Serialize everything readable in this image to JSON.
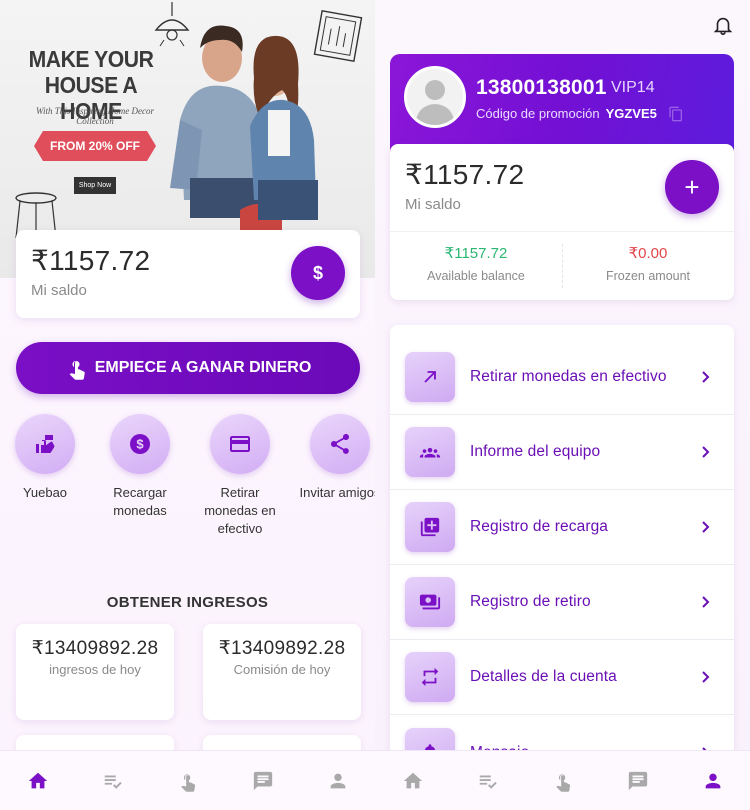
{
  "colors": {
    "accent": "#7b10c6",
    "green": "#2bb673",
    "red": "#e0454a"
  },
  "banner": {
    "headline": "MAKE YOUR HOUSE A HOME",
    "subtitle": "With This Inspiring Home Decor Collection",
    "ribbon": "FROM 20% OFF",
    "shop_now": "Shop Now"
  },
  "left": {
    "balance_amount": "₹1157.72",
    "balance_label": "Mi saldo",
    "earn_button": "EMPIECE A GANAR DINERO",
    "quick_actions": [
      {
        "label": "Yuebao",
        "icon": "wallet-hand-icon"
      },
      {
        "label": "Recargar monedas",
        "icon": "dollar-circle-icon"
      },
      {
        "label": "Retirar monedas en efectivo",
        "icon": "card-icon"
      },
      {
        "label": "Invitar amigos",
        "icon": "share-icon"
      }
    ],
    "section_title": "OBTENER INGRESOS",
    "stats": [
      {
        "value": "₹13409892.28",
        "caption": "ingresos de hoy"
      },
      {
        "value": "₹13409892.28",
        "caption": "Comisión de hoy"
      }
    ]
  },
  "right": {
    "phone": "13800138001",
    "vip": "VIP14",
    "promo_label": "Código de promoción",
    "promo_code": "YGZVE5",
    "balance_amount": "₹1157.72",
    "balance_label": "Mi saldo",
    "available_value": "₹1157.72",
    "available_label": "Available balance",
    "frozen_value": "₹0.00",
    "frozen_label": "Frozen amount",
    "menu": [
      {
        "label": "Retirar monedas en efectivo",
        "icon": "arrow-up-right-icon"
      },
      {
        "label": "Informe del equipo",
        "icon": "team-icon"
      },
      {
        "label": "Registro de recarga",
        "icon": "add-box-icon"
      },
      {
        "label": "Registro de retiro",
        "icon": "money-icon"
      },
      {
        "label": "Detalles de la cuenta",
        "icon": "swap-icon"
      },
      {
        "label": "Mensaje",
        "icon": "bell-icon"
      }
    ]
  },
  "tabbar": [
    "home-icon",
    "task-list-icon",
    "tap-icon",
    "message-icon",
    "person-icon"
  ]
}
